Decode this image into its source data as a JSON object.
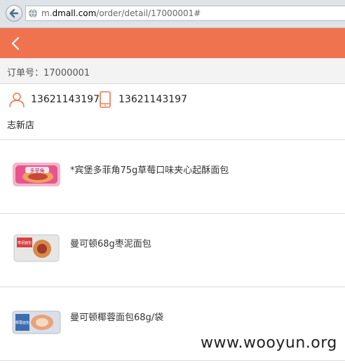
{
  "browser": {
    "url_prefix": "m.",
    "url_domain": "dmall.com",
    "url_path": "/order/detail/17000001#"
  },
  "order": {
    "label": "订单号：17000001"
  },
  "contact": {
    "phone_primary": "13621143197",
    "phone_mobile": "13621143197",
    "store_name": "志新店"
  },
  "products": [
    {
      "name": "*宾堡多菲角75g草莓口味夹心起酥面包",
      "thumb_text": "多菲角"
    },
    {
      "name": "曼可顿68g枣泥面包",
      "thumb_text": "枣泥面包"
    },
    {
      "name": "曼可顿椰蓉面包68g/袋",
      "thumb_text": "椰蓉面包"
    }
  ],
  "watermark": "www.wooyun.org",
  "colors": {
    "header": "#f07350",
    "accent": "#f07350"
  }
}
